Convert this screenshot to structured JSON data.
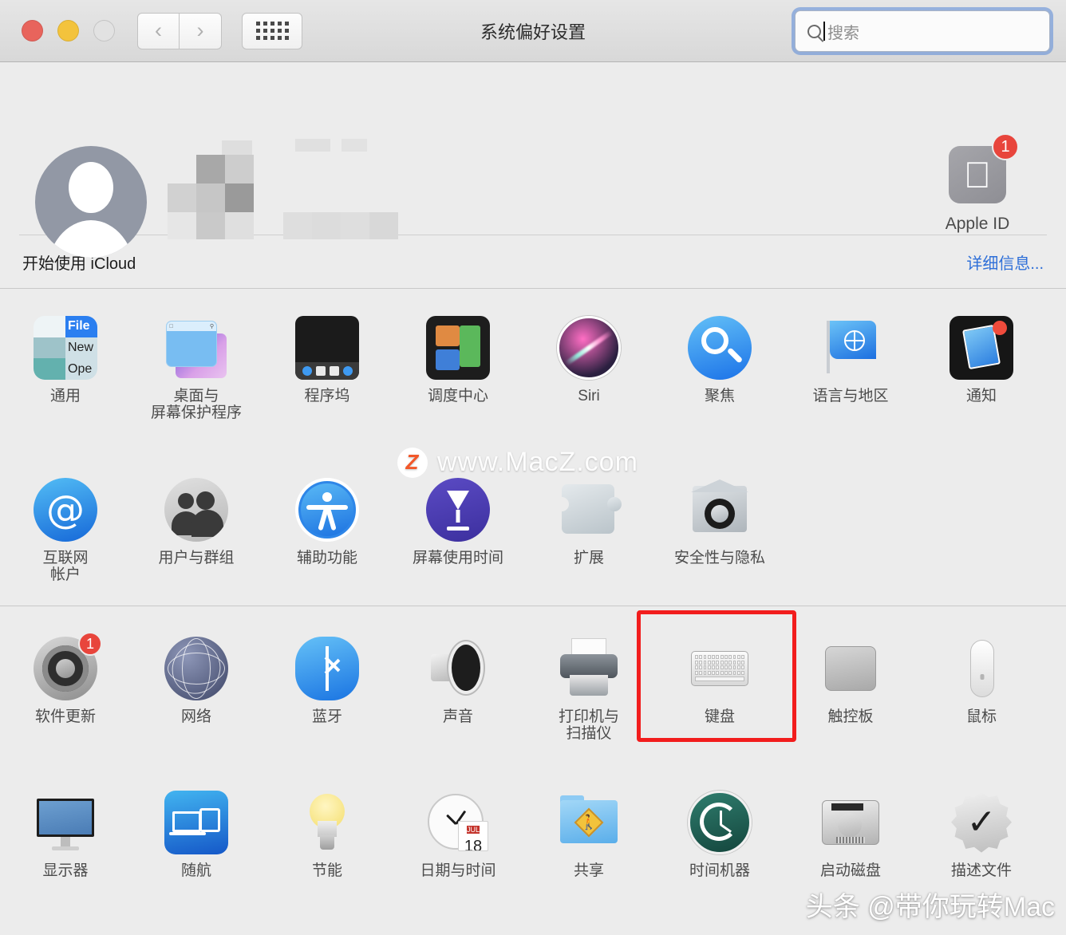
{
  "window": {
    "title": "系统偏好设置",
    "traffic_lights": [
      "close",
      "minimize",
      "zoom"
    ],
    "nav": {
      "back_icon": "chevron-left-icon",
      "forward_icon": "chevron-right-icon",
      "grid_icon": "show-all-grid-icon"
    },
    "search": {
      "placeholder": "搜索",
      "value": "",
      "icon": "search-icon",
      "focused": true
    }
  },
  "account": {
    "avatar_icon": "default-user-avatar-icon",
    "name_redacted": true,
    "apple_id": {
      "label": "Apple ID",
      "icon": "apple-logo-icon",
      "badge": "1"
    }
  },
  "icloud_banner": {
    "text": "开始使用 iCloud",
    "link": "详细信息..."
  },
  "sections": [
    {
      "rows": [
        [
          {
            "label": "通用",
            "icon": "general-icon"
          },
          {
            "label": "桌面与\n屏幕保护程序",
            "icon": "desktop-screensaver-icon"
          },
          {
            "label": "程序坞",
            "icon": "dock-icon"
          },
          {
            "label": "调度中心",
            "icon": "mission-control-icon"
          },
          {
            "label": "Siri",
            "icon": "siri-icon"
          },
          {
            "label": "聚焦",
            "icon": "spotlight-icon"
          },
          {
            "label": "语言与地区",
            "icon": "language-region-icon"
          },
          {
            "label": "通知",
            "icon": "notifications-icon"
          }
        ],
        [
          {
            "label": "互联网\n帐户",
            "icon": "internet-accounts-icon"
          },
          {
            "label": "用户与群组",
            "icon": "users-groups-icon"
          },
          {
            "label": "辅助功能",
            "icon": "accessibility-icon"
          },
          {
            "label": "屏幕使用时间",
            "icon": "screen-time-icon"
          },
          {
            "label": "扩展",
            "icon": "extensions-icon"
          },
          {
            "label": "安全性与隐私",
            "icon": "security-privacy-icon"
          }
        ]
      ]
    },
    {
      "rows": [
        [
          {
            "label": "软件更新",
            "icon": "software-update-icon",
            "badge": "1"
          },
          {
            "label": "网络",
            "icon": "network-icon"
          },
          {
            "label": "蓝牙",
            "icon": "bluetooth-icon"
          },
          {
            "label": "声音",
            "icon": "sound-icon"
          },
          {
            "label": "打印机与\n扫描仪",
            "icon": "printers-scanners-icon"
          },
          {
            "label": "键盘",
            "icon": "keyboard-icon",
            "highlighted": true
          },
          {
            "label": "触控板",
            "icon": "trackpad-icon"
          },
          {
            "label": "鼠标",
            "icon": "mouse-icon"
          }
        ],
        [
          {
            "label": "显示器",
            "icon": "displays-icon"
          },
          {
            "label": "随航",
            "icon": "sidecar-icon"
          },
          {
            "label": "节能",
            "icon": "energy-saver-icon"
          },
          {
            "label": "日期与时间",
            "icon": "date-time-icon",
            "calendar_month": "JUL",
            "calendar_day": "18"
          },
          {
            "label": "共享",
            "icon": "sharing-icon"
          },
          {
            "label": "时间机器",
            "icon": "time-machine-icon"
          },
          {
            "label": "启动磁盘",
            "icon": "startup-disk-icon"
          },
          {
            "label": "描述文件",
            "icon": "profiles-icon"
          }
        ]
      ]
    }
  ],
  "watermarks": {
    "center": "www.MacZ.com",
    "center_logo": "Z",
    "bottom": "头条 @带你玩转Mac"
  },
  "highlight_color": "#f21d1d"
}
